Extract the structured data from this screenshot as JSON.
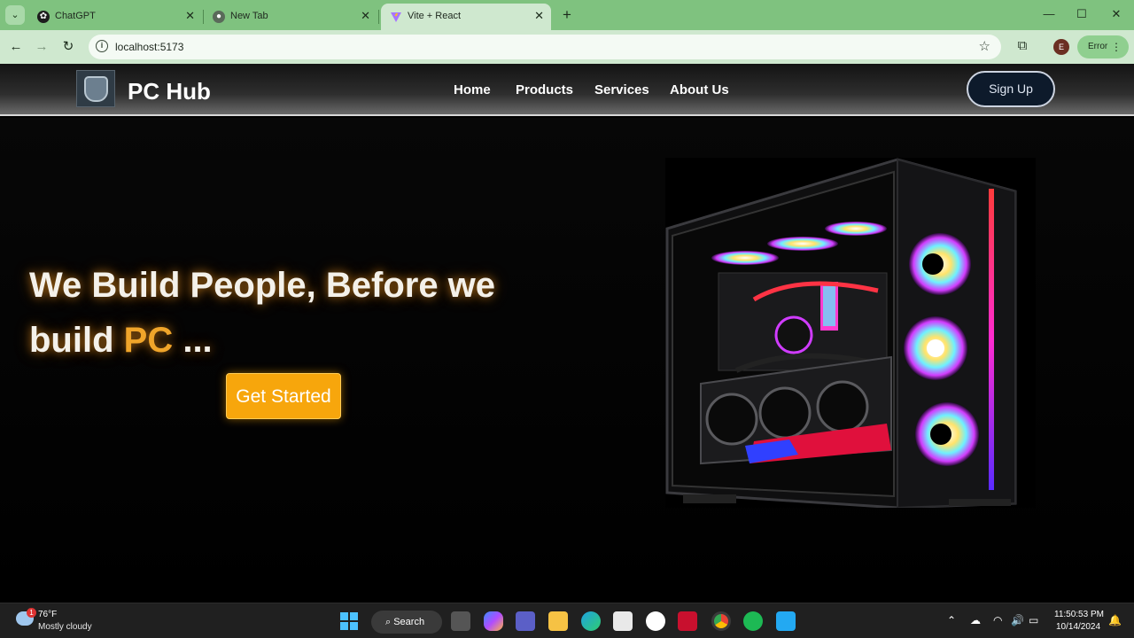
{
  "browser": {
    "tabs": [
      {
        "title": "ChatGPT",
        "icon": "chatgpt-icon",
        "active": false
      },
      {
        "title": "New Tab",
        "icon": "chrome-icon",
        "active": false
      },
      {
        "title": "Vite + React",
        "icon": "vite-icon",
        "active": true
      }
    ],
    "url": "localhost:5173",
    "profile_initial": "E",
    "error_label": "Error",
    "colors": {
      "tabbar": "#7fc27f",
      "toolbar": "#cfe8cf"
    }
  },
  "site": {
    "brand": "PC Hub",
    "nav": [
      "Home",
      "Products",
      "Services",
      "About Us"
    ],
    "signup": "Sign Up",
    "headline": {
      "line1": "We Build People, Before we",
      "line2_prefix": "build ",
      "accent": "PC",
      "suffix": " ..."
    },
    "cta": "Get Started",
    "colors": {
      "accent": "#f0a52a",
      "cta": "#f7a60c"
    }
  },
  "taskbar": {
    "weather": {
      "badge": "1",
      "temp": "76°F",
      "condition": "Mostly cloudy"
    },
    "search": "Search",
    "time": "11:50:53 PM",
    "date": "10/14/2024"
  }
}
